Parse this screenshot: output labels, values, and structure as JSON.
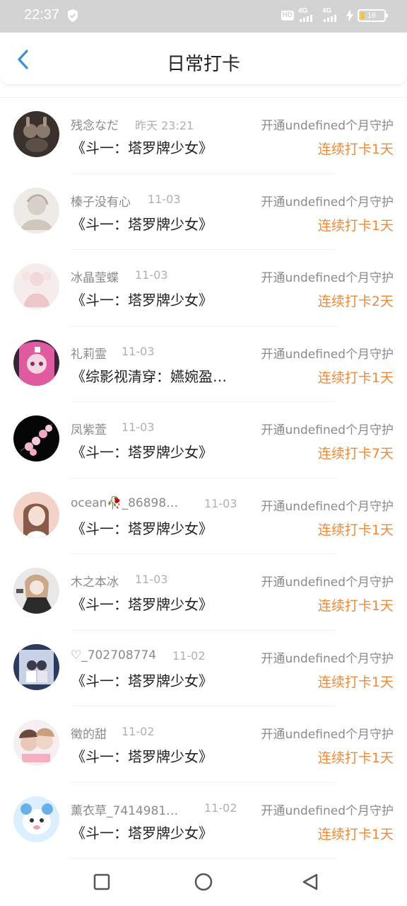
{
  "status": {
    "time": "22:37",
    "battery_level": "16",
    "network_a": "4G",
    "network_b": "4G",
    "hd_badge": "HD"
  },
  "header": {
    "title": "日常打卡"
  },
  "colors": {
    "accent_orange": "#f08a3a",
    "back_arrow_blue": "#3a8fd8"
  },
  "entries": [
    {
      "username": "残念なだ",
      "time": "昨天 23:21",
      "guard": "开通undefined个月守护",
      "book": "《斗一：塔罗牌少女》",
      "streak": "连续打卡1天"
    },
    {
      "username": "榛子没有心",
      "time": "11-03",
      "guard": "开通undefined个月守护",
      "book": "《斗一：塔罗牌少女》",
      "streak": "连续打卡1天"
    },
    {
      "username": "冰晶莹蝶",
      "time": "11-03",
      "guard": "开通undefined个月守护",
      "book": "《斗一：塔罗牌少女》",
      "streak": "连续打卡2天"
    },
    {
      "username": "礼莉霊",
      "time": "11-03",
      "guard": "开通undefined个月守护",
      "book": "《综影视清穿：嬿婉盈…",
      "streak": "连续打卡1天"
    },
    {
      "username": "凤紫萱",
      "time": "11-03",
      "guard": "开通undefined个月守护",
      "book": "《斗一：塔罗牌少女》",
      "streak": "连续打卡7天"
    },
    {
      "username": "ocean🥀_86898…",
      "time": "11-03",
      "guard": "开通undefined个月守护",
      "book": "《斗一：塔罗牌少女》",
      "streak": "连续打卡1天"
    },
    {
      "username": "木之本冰",
      "time": "11-03",
      "guard": "开通undefined个月守护",
      "book": "《斗一：塔罗牌少女》",
      "streak": "连续打卡1天"
    },
    {
      "username": "♡_702708774",
      "time": "11-02",
      "guard": "开通undefined个月守护",
      "book": "《斗一：塔罗牌少女》",
      "streak": "连续打卡1天"
    },
    {
      "username": "徵的甜",
      "time": "11-02",
      "guard": "开通undefined个月守护",
      "book": "《斗一：塔罗牌少女》",
      "streak": "连续打卡1天"
    },
    {
      "username": "薰衣草_7414981…",
      "time": "11-02",
      "guard": "开通undefined个月守护",
      "book": "《斗一：塔罗牌少女》",
      "streak": "连续打卡1天"
    }
  ]
}
